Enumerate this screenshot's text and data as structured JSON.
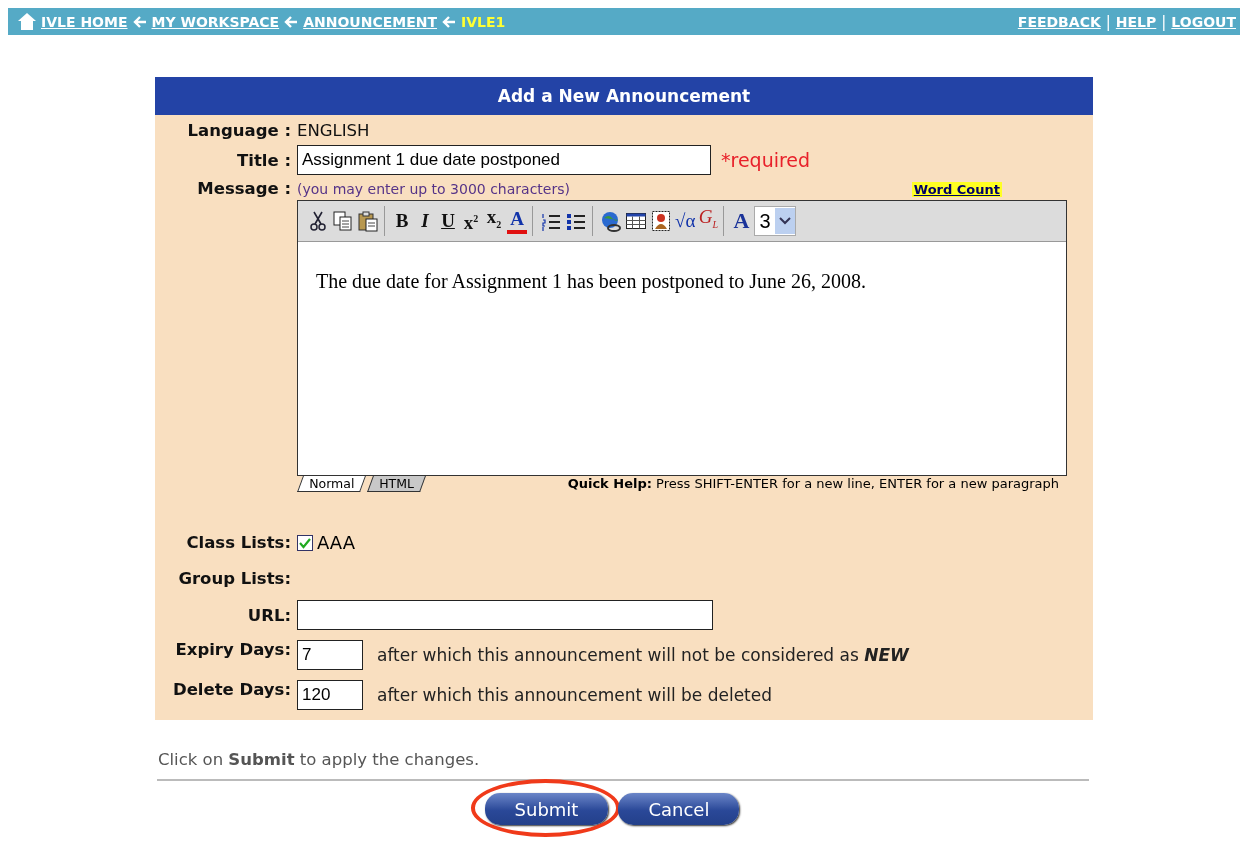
{
  "nav": {
    "breadcrumbs": [
      {
        "label": "IVLE HOME",
        "current": false
      },
      {
        "label": "MY WORKSPACE",
        "current": false
      },
      {
        "label": "ANNOUNCEMENT",
        "current": false
      },
      {
        "label": "IVLE1",
        "current": true
      }
    ],
    "links": [
      "FEEDBACK",
      "HELP",
      "LOGOUT"
    ],
    "separator": "|"
  },
  "form": {
    "title": "Add a New Announcement",
    "language": {
      "label": "Language :",
      "value": "ENGLISH"
    },
    "title_field": {
      "label": "Title :",
      "value": "Assignment 1 due date postponed",
      "required": "*required"
    },
    "message": {
      "label": "Message :",
      "hint": "(you may enter up to 3000 characters)",
      "word_count": "Word Count",
      "toolbar": [
        [
          {
            "kind": "cut"
          },
          {
            "kind": "copy"
          },
          {
            "kind": "paste"
          }
        ],
        [
          {
            "kind": "bold",
            "label": "B"
          },
          {
            "kind": "italic",
            "label": "I"
          },
          {
            "kind": "underline",
            "label": "U"
          },
          {
            "kind": "superscript",
            "label": "x",
            "mark": "2"
          },
          {
            "kind": "subscript",
            "label": "x",
            "mark": "2"
          },
          {
            "kind": "fontcolor",
            "label": "A"
          }
        ],
        [
          {
            "kind": "olist"
          },
          {
            "kind": "ulist"
          }
        ],
        [
          {
            "kind": "link"
          },
          {
            "kind": "table"
          },
          {
            "kind": "image"
          },
          {
            "kind": "math",
            "label": "√α"
          },
          {
            "kind": "glossary",
            "label": "G",
            "mark": "L"
          }
        ],
        [
          {
            "kind": "font",
            "label": "A"
          },
          {
            "kind": "size",
            "value": "3"
          }
        ]
      ],
      "body": "The due date for Assignment 1 has been postponed to June 26, 2008.",
      "tabs": [
        {
          "label": "Normal",
          "selected": true
        },
        {
          "label": "HTML",
          "selected": false
        }
      ],
      "quick_help": "**Quick Help:** Press SHIFT-ENTER for a new line, ENTER for a new paragraph"
    },
    "class_lists": {
      "label": "Class Lists:",
      "items": [
        {
          "label": "AAA",
          "checked": true
        }
      ]
    },
    "group_lists": {
      "label": "Group Lists:"
    },
    "url": {
      "label": "URL:"
    },
    "expiry": {
      "label": "Expiry Days:",
      "value": "7",
      "note": "after which this announcement will not be considered as **NEW**"
    },
    "delete": {
      "label": "Delete Days:",
      "value": "120",
      "note": "after which this announcement will be deleted"
    }
  },
  "footer": {
    "instruction": "Click on **Submit** to apply the changes.",
    "buttons": [
      {
        "label": "Submit",
        "highlighted": true
      },
      {
        "label": "Cancel",
        "highlighted": false
      }
    ]
  }
}
